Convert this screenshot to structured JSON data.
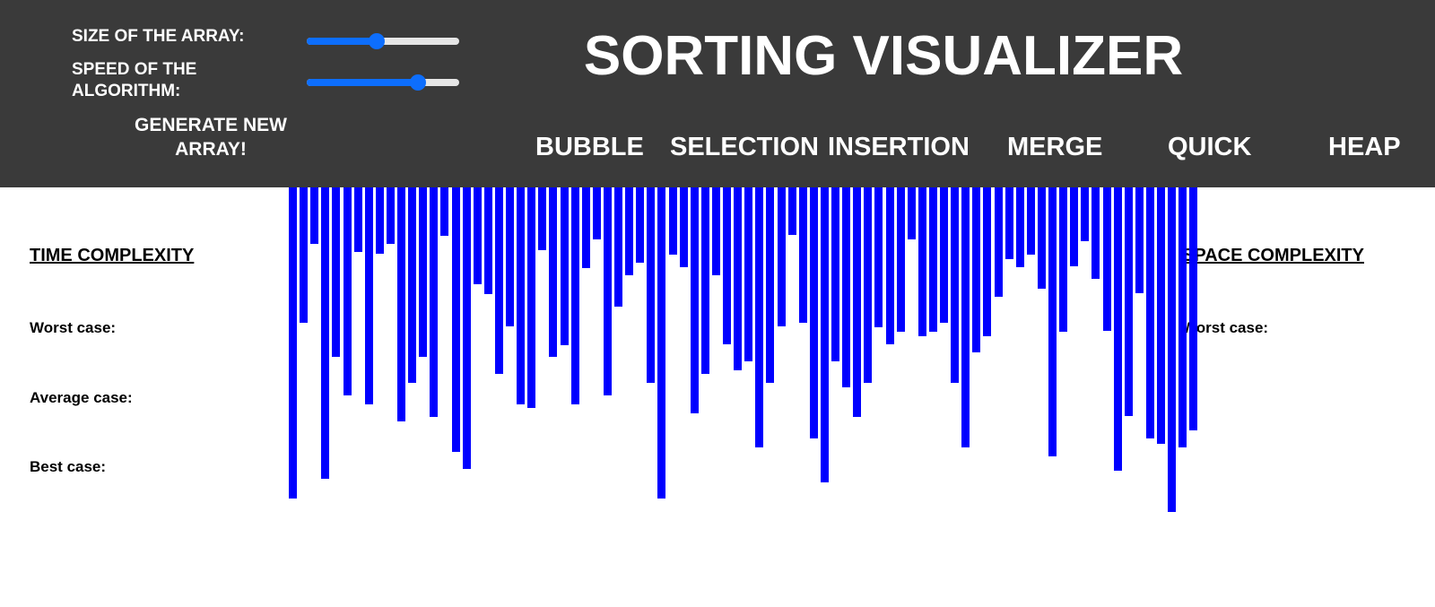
{
  "header": {
    "title": "SORTING VISUALIZER",
    "size_label": "SIZE OF THE ARRAY:",
    "speed_label_line1": "SPEED OF THE",
    "speed_label_line2": "ALGORITHM:",
    "size_value": 0.46,
    "speed_value": 0.73,
    "generate_line1": "GENERATE NEW",
    "generate_line2": "ARRAY!",
    "algorithms": [
      "BUBBLE",
      "SELECTION",
      "INSERTION",
      "MERGE",
      "QUICK",
      "HEAP"
    ]
  },
  "time_complexity": {
    "heading": "TIME COMPLEXITY",
    "worst": "Worst case:",
    "average": "Average case:",
    "best": "Best case:"
  },
  "space_complexity": {
    "heading": "SPACE COMPLEXITY",
    "worst": "Worst case:"
  },
  "colors": {
    "header_bg": "#3a3a3a",
    "bar_color": "#0000ff",
    "slider_accent": "#0d6efd"
  },
  "array": {
    "values": [
      347,
      151,
      63,
      325,
      189,
      232,
      72,
      242,
      74,
      63,
      261,
      218,
      189,
      256,
      54,
      295,
      314,
      108,
      119,
      208,
      155,
      242,
      246,
      70,
      189,
      176,
      242,
      90,
      58,
      232,
      133,
      98,
      84,
      218,
      347,
      75,
      89,
      252,
      208,
      98,
      175,
      204,
      194,
      290,
      218,
      155,
      53,
      151,
      280,
      329,
      194,
      223,
      256,
      218,
      156,
      175,
      161,
      58,
      166,
      161,
      151,
      218,
      290,
      184,
      166,
      122,
      80,
      89,
      75,
      113,
      300,
      161,
      88,
      60,
      102,
      160,
      316,
      255,
      118,
      280,
      286,
      362,
      290,
      271
    ]
  }
}
